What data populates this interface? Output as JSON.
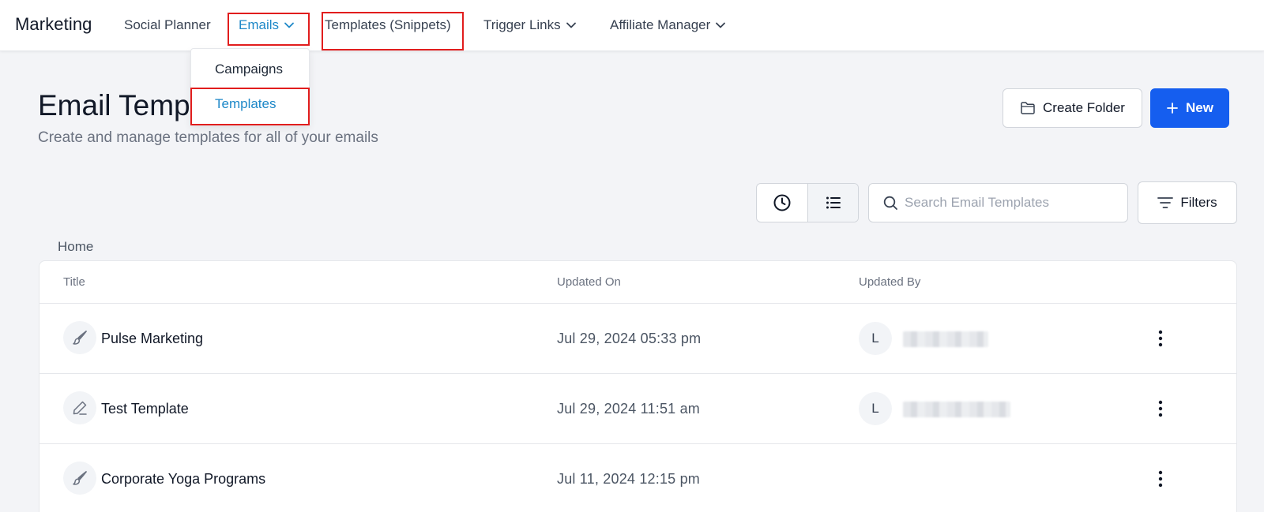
{
  "nav": {
    "brand": "Marketing",
    "items": [
      {
        "label": "Social Planner"
      },
      {
        "label": "Emails"
      },
      {
        "label": "Templates (Snippets)"
      },
      {
        "label": "Trigger Links"
      },
      {
        "label": "Affiliate Manager"
      }
    ],
    "dropdown": {
      "items": [
        {
          "label": "Campaigns"
        },
        {
          "label": "Templates"
        }
      ]
    }
  },
  "header": {
    "title": "Email Templates",
    "subtitle": "Create and manage templates for all of your emails",
    "create_folder_label": "Create Folder",
    "new_label": "New"
  },
  "toolbar": {
    "search_placeholder": "Search Email Templates",
    "filters_label": "Filters"
  },
  "breadcrumb": "Home",
  "table": {
    "columns": {
      "title": "Title",
      "updated_on": "Updated On",
      "updated_by": "Updated By"
    },
    "rows": [
      {
        "title": "Pulse Marketing",
        "updated_on": "Jul 29, 2024 05:33 pm",
        "avatar": "L",
        "icon": "brush-icon"
      },
      {
        "title": "Test Template",
        "updated_on": "Jul 29, 2024 11:51 am",
        "avatar": "L",
        "icon": "pen-icon"
      },
      {
        "title": "Corporate Yoga Programs",
        "updated_on": "Jul 11, 2024 12:15 pm",
        "avatar": "",
        "icon": "brush-icon"
      }
    ]
  },
  "colors": {
    "accent": "#1e88c8",
    "primary_button": "#155eef",
    "highlight": "#e11d1d"
  }
}
